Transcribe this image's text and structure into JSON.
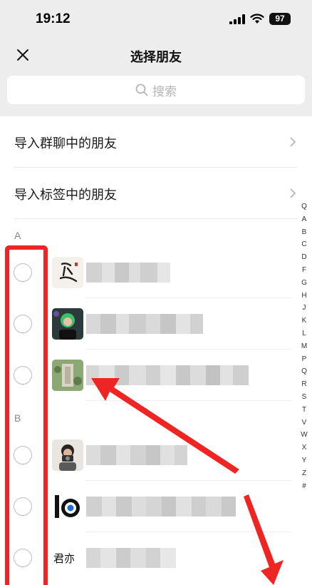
{
  "status_bar": {
    "time": "19:12",
    "battery": "97"
  },
  "nav": {
    "title": "选择朋友",
    "close_icon": "close-icon"
  },
  "search": {
    "placeholder": "搜索"
  },
  "import_items": [
    {
      "label": "导入群聊中的朋友"
    },
    {
      "label": "导入标签中的朋友"
    }
  ],
  "sections": [
    {
      "letter": "A",
      "contacts": [
        {
          "avatar_icon": "calligraphy-avatar"
        },
        {
          "avatar_icon": "person-green-hair-avatar"
        },
        {
          "avatar_icon": "aerial-building-avatar"
        }
      ]
    },
    {
      "letter": "B",
      "contacts": [
        {
          "avatar_icon": "person-camera-avatar"
        },
        {
          "avatar_icon": "logo-ring-avatar"
        },
        {
          "avatar_icon": "text-logo-avatar",
          "avatar_text": "君亦"
        }
      ]
    }
  ],
  "index_bar": [
    "Q",
    "A",
    "B",
    "C",
    "D",
    "F",
    "G",
    "H",
    "J",
    "K",
    "L",
    "M",
    "P",
    "Q",
    "R",
    "S",
    "T",
    "V",
    "W",
    "X",
    "Y",
    "Z",
    "#"
  ],
  "colors": {
    "annotation_red": "#ee2522",
    "background_gray": "#ededed"
  }
}
